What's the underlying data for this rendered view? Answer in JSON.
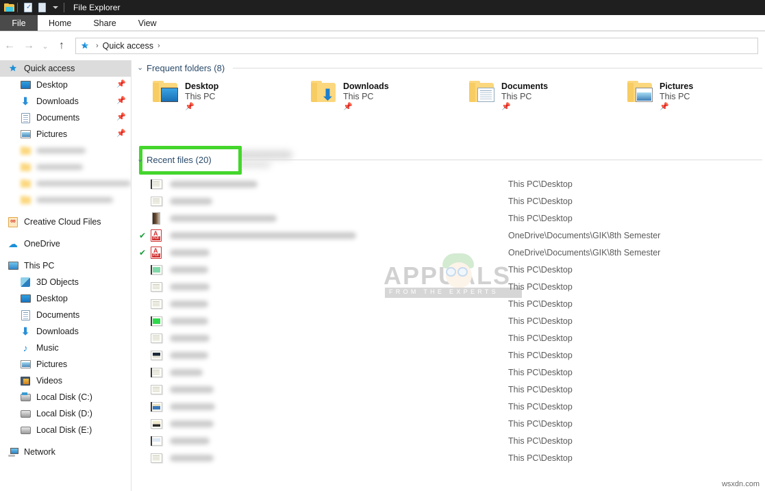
{
  "window": {
    "title": "File Explorer",
    "quick_access_toolbar": [
      {
        "name": "folder-icon"
      },
      {
        "name": "properties-icon"
      },
      {
        "name": "new-folder-icon"
      },
      {
        "name": "customize-dropdown-icon"
      }
    ]
  },
  "ribbon": {
    "tabs": [
      {
        "label": "File",
        "selected": true
      },
      {
        "label": "Home",
        "selected": false
      },
      {
        "label": "Share",
        "selected": false
      },
      {
        "label": "View",
        "selected": false
      }
    ]
  },
  "navbar": {
    "back": "←",
    "forward": "→",
    "recent": "⌄",
    "up": "↑",
    "breadcrumb": {
      "icon": "quick-access-star-icon",
      "items": [
        "Quick access"
      ],
      "separator": "›"
    }
  },
  "sidebar": {
    "items": [
      {
        "label": "Quick access",
        "icon": "star-icon",
        "selected": true,
        "pinned": false,
        "indent": false
      },
      {
        "label": "Desktop",
        "icon": "desktop-icon",
        "selected": false,
        "pinned": true,
        "indent": true
      },
      {
        "label": "Downloads",
        "icon": "download-icon",
        "selected": false,
        "pinned": true,
        "indent": true
      },
      {
        "label": "Documents",
        "icon": "documents-icon",
        "selected": false,
        "pinned": true,
        "indent": true
      },
      {
        "label": "Pictures",
        "icon": "pictures-icon",
        "selected": false,
        "pinned": true,
        "indent": true
      },
      {
        "label": "",
        "icon": "folder-icon",
        "selected": false,
        "pinned": false,
        "indent": true,
        "blurred": true,
        "blur_width": 72
      },
      {
        "label": "",
        "icon": "folder-icon",
        "selected": false,
        "pinned": false,
        "indent": true,
        "blurred": true,
        "blur_width": 68
      },
      {
        "label": "",
        "icon": "folder-icon",
        "selected": false,
        "pinned": false,
        "indent": true,
        "blurred": true,
        "blur_width": 148
      },
      {
        "label": "",
        "icon": "folder-icon",
        "selected": false,
        "pinned": false,
        "indent": true,
        "blurred": true,
        "blur_width": 112
      }
    ],
    "groups": [
      {
        "label": "Creative Cloud Files",
        "icon": "creative-cloud-icon"
      },
      {
        "label": "OneDrive",
        "icon": "onedrive-cloud-icon"
      },
      {
        "label": "This PC",
        "icon": "this-pc-icon"
      }
    ],
    "thispc_children": [
      {
        "label": "3D Objects",
        "icon": "3d-objects-icon"
      },
      {
        "label": "Desktop",
        "icon": "desktop-icon"
      },
      {
        "label": "Documents",
        "icon": "documents-icon"
      },
      {
        "label": "Downloads",
        "icon": "download-icon"
      },
      {
        "label": "Music",
        "icon": "music-icon"
      },
      {
        "label": "Pictures",
        "icon": "pictures-icon"
      },
      {
        "label": "Videos",
        "icon": "videos-icon"
      },
      {
        "label": "Local Disk (C:)",
        "icon": "system-drive-icon"
      },
      {
        "label": "Local Disk (D:)",
        "icon": "drive-icon"
      },
      {
        "label": "Local Disk (E:)",
        "icon": "drive-icon"
      }
    ],
    "network": {
      "label": "Network",
      "icon": "network-icon"
    }
  },
  "content": {
    "frequent_folders": {
      "header": "Frequent folders (8)",
      "chevron": "⌄",
      "tiles": [
        {
          "name": "Desktop",
          "location": "This PC",
          "pinned": true,
          "embed": "desktop"
        },
        {
          "name": "Downloads",
          "location": "This PC",
          "pinned": true,
          "embed": "download"
        },
        {
          "name": "Documents",
          "location": "This PC",
          "pinned": true,
          "embed": "documents"
        },
        {
          "name": "Pictures",
          "location": "This PC",
          "pinned": true,
          "embed": "pictures"
        }
      ]
    },
    "recent_files": {
      "header": "Recent files (20)",
      "chevron": "⌄",
      "highlighted": true,
      "highlight_color": "#44d62c",
      "rows": [
        {
          "path": "This PC\\Desktop",
          "icon": "image-thumbnail",
          "sync": false,
          "name_width": 128,
          "variant": "light"
        },
        {
          "path": "This PC\\Desktop",
          "icon": "image-thumbnail",
          "sync": false,
          "name_width": 62,
          "variant": "light"
        },
        {
          "path": "This PC\\Desktop",
          "icon": "dark-thumbnail",
          "sync": false,
          "name_width": 156,
          "variant": "dark"
        },
        {
          "path": "OneDrive\\Documents\\GIK\\8th Semester",
          "icon": "pdf-icon",
          "sync": true,
          "name_width": 272,
          "variant": "pdf"
        },
        {
          "path": "OneDrive\\Documents\\GIK\\8th Semester",
          "icon": "pdf-icon",
          "sync": true,
          "name_width": 58,
          "variant": "pdf"
        },
        {
          "path": "This PC\\Desktop",
          "icon": "image-thumbnail",
          "sync": false,
          "name_width": 56,
          "variant": "green"
        },
        {
          "path": "This PC\\Desktop",
          "icon": "image-thumbnail",
          "sync": false,
          "name_width": 58,
          "variant": "light"
        },
        {
          "path": "This PC\\Desktop",
          "icon": "image-thumbnail",
          "sync": false,
          "name_width": 56,
          "variant": "light"
        },
        {
          "path": "This PC\\Desktop",
          "icon": "image-thumbnail",
          "sync": false,
          "name_width": 56,
          "variant": "green"
        },
        {
          "path": "This PC\\Desktop",
          "icon": "image-thumbnail",
          "sync": false,
          "name_width": 58,
          "variant": "light"
        },
        {
          "path": "This PC\\Desktop",
          "icon": "image-thumbnail",
          "sync": false,
          "name_width": 56,
          "variant": "dark"
        },
        {
          "path": "This PC\\Desktop",
          "icon": "image-thumbnail",
          "sync": false,
          "name_width": 48,
          "variant": "light"
        },
        {
          "path": "This PC\\Desktop",
          "icon": "image-thumbnail",
          "sync": false,
          "name_width": 64,
          "variant": "light"
        },
        {
          "path": "This PC\\Desktop",
          "icon": "image-thumbnail",
          "sync": false,
          "name_width": 66,
          "variant": "photo"
        },
        {
          "path": "This PC\\Desktop",
          "icon": "image-thumbnail",
          "sync": false,
          "name_width": 64,
          "variant": "light"
        },
        {
          "path": "This PC\\Desktop",
          "icon": "image-thumbnail",
          "sync": false,
          "name_width": 58,
          "variant": "doc"
        },
        {
          "path": "This PC\\Desktop",
          "icon": "image-thumbnail",
          "sync": false,
          "name_width": 64,
          "variant": "light"
        }
      ]
    }
  },
  "watermarks": {
    "appuals": {
      "word": "APPUALS",
      "tagline": "FROM THE EXPERTS"
    },
    "source": "wsxdn.com"
  }
}
